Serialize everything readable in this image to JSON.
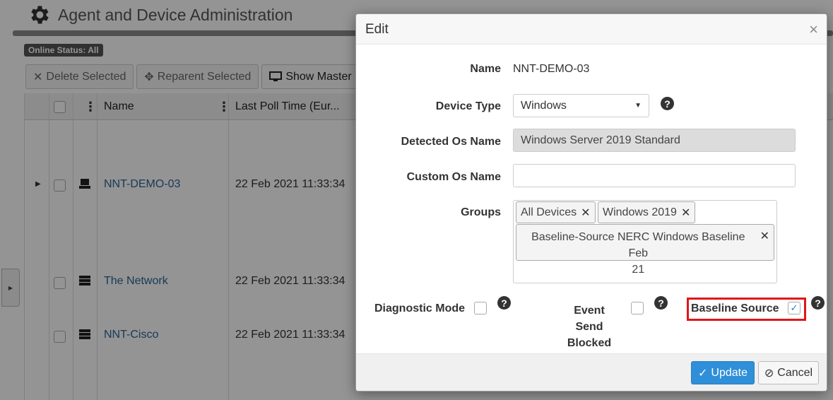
{
  "page": {
    "title": "Agent and Device Administration",
    "status_badge": "Online Status: All"
  },
  "toolbar": {
    "delete_label": "Delete Selected",
    "reparent_label": "Reparent Selected",
    "show_master_label": "Show Master P"
  },
  "grid": {
    "columns": [
      "Name",
      "Last Poll Time (Eur..."
    ],
    "rows": [
      {
        "name": "NNT-DEMO-03",
        "last_poll": "22 Feb 2021 11:33:34",
        "icon": "laptop-icon"
      },
      {
        "name": "The Network",
        "last_poll": "22 Feb 2021 11:33:34",
        "icon": "server-stack-icon"
      },
      {
        "name": "NNT-Cisco",
        "last_poll": "22 Feb 2021 11:33:34",
        "icon": "server-stack-icon"
      }
    ]
  },
  "modal": {
    "title": "Edit",
    "close_glyph": "×",
    "name_label": "Name",
    "name_value": "NNT-DEMO-03",
    "device_type_label": "Device Type",
    "device_type_value": "Windows",
    "detected_os_label": "Detected Os Name",
    "detected_os_value": "Windows Server 2019 Standard",
    "custom_os_label": "Custom Os Name",
    "custom_os_value": "",
    "groups_label": "Groups",
    "groups": [
      "All Devices",
      "Windows 2019",
      "Baseline-Source NERC Windows Baseline Feb",
      "21"
    ],
    "diagnostic_label": "Diagnostic Mode",
    "diagnostic_checked": false,
    "event_send_label_1": "Event Send",
    "event_send_label_2": "Blocked",
    "event_send_checked": false,
    "baseline_label": "Baseline Source",
    "baseline_checked": true,
    "update_label": "Update",
    "cancel_label": "Cancel"
  },
  "colors": {
    "primary": "#2f8fd8",
    "highlight": "#e0161b",
    "link": "#2a6496"
  }
}
